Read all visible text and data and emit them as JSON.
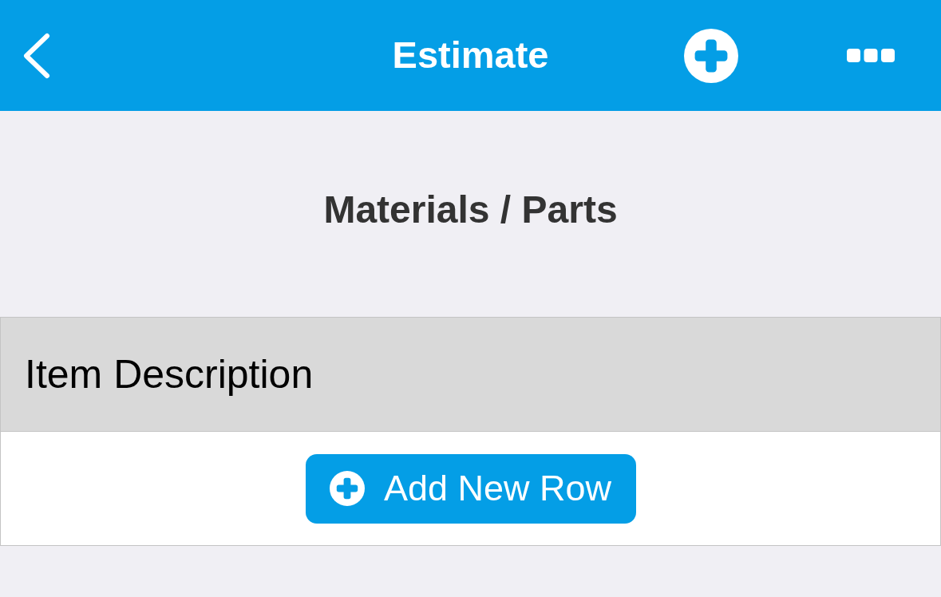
{
  "nav_bar": {
    "title": "Estimate"
  },
  "section": {
    "title": "Materials / Parts"
  },
  "table": {
    "columns": [
      "Item Description"
    ],
    "add_button": {
      "label": "Add New Row"
    }
  }
}
